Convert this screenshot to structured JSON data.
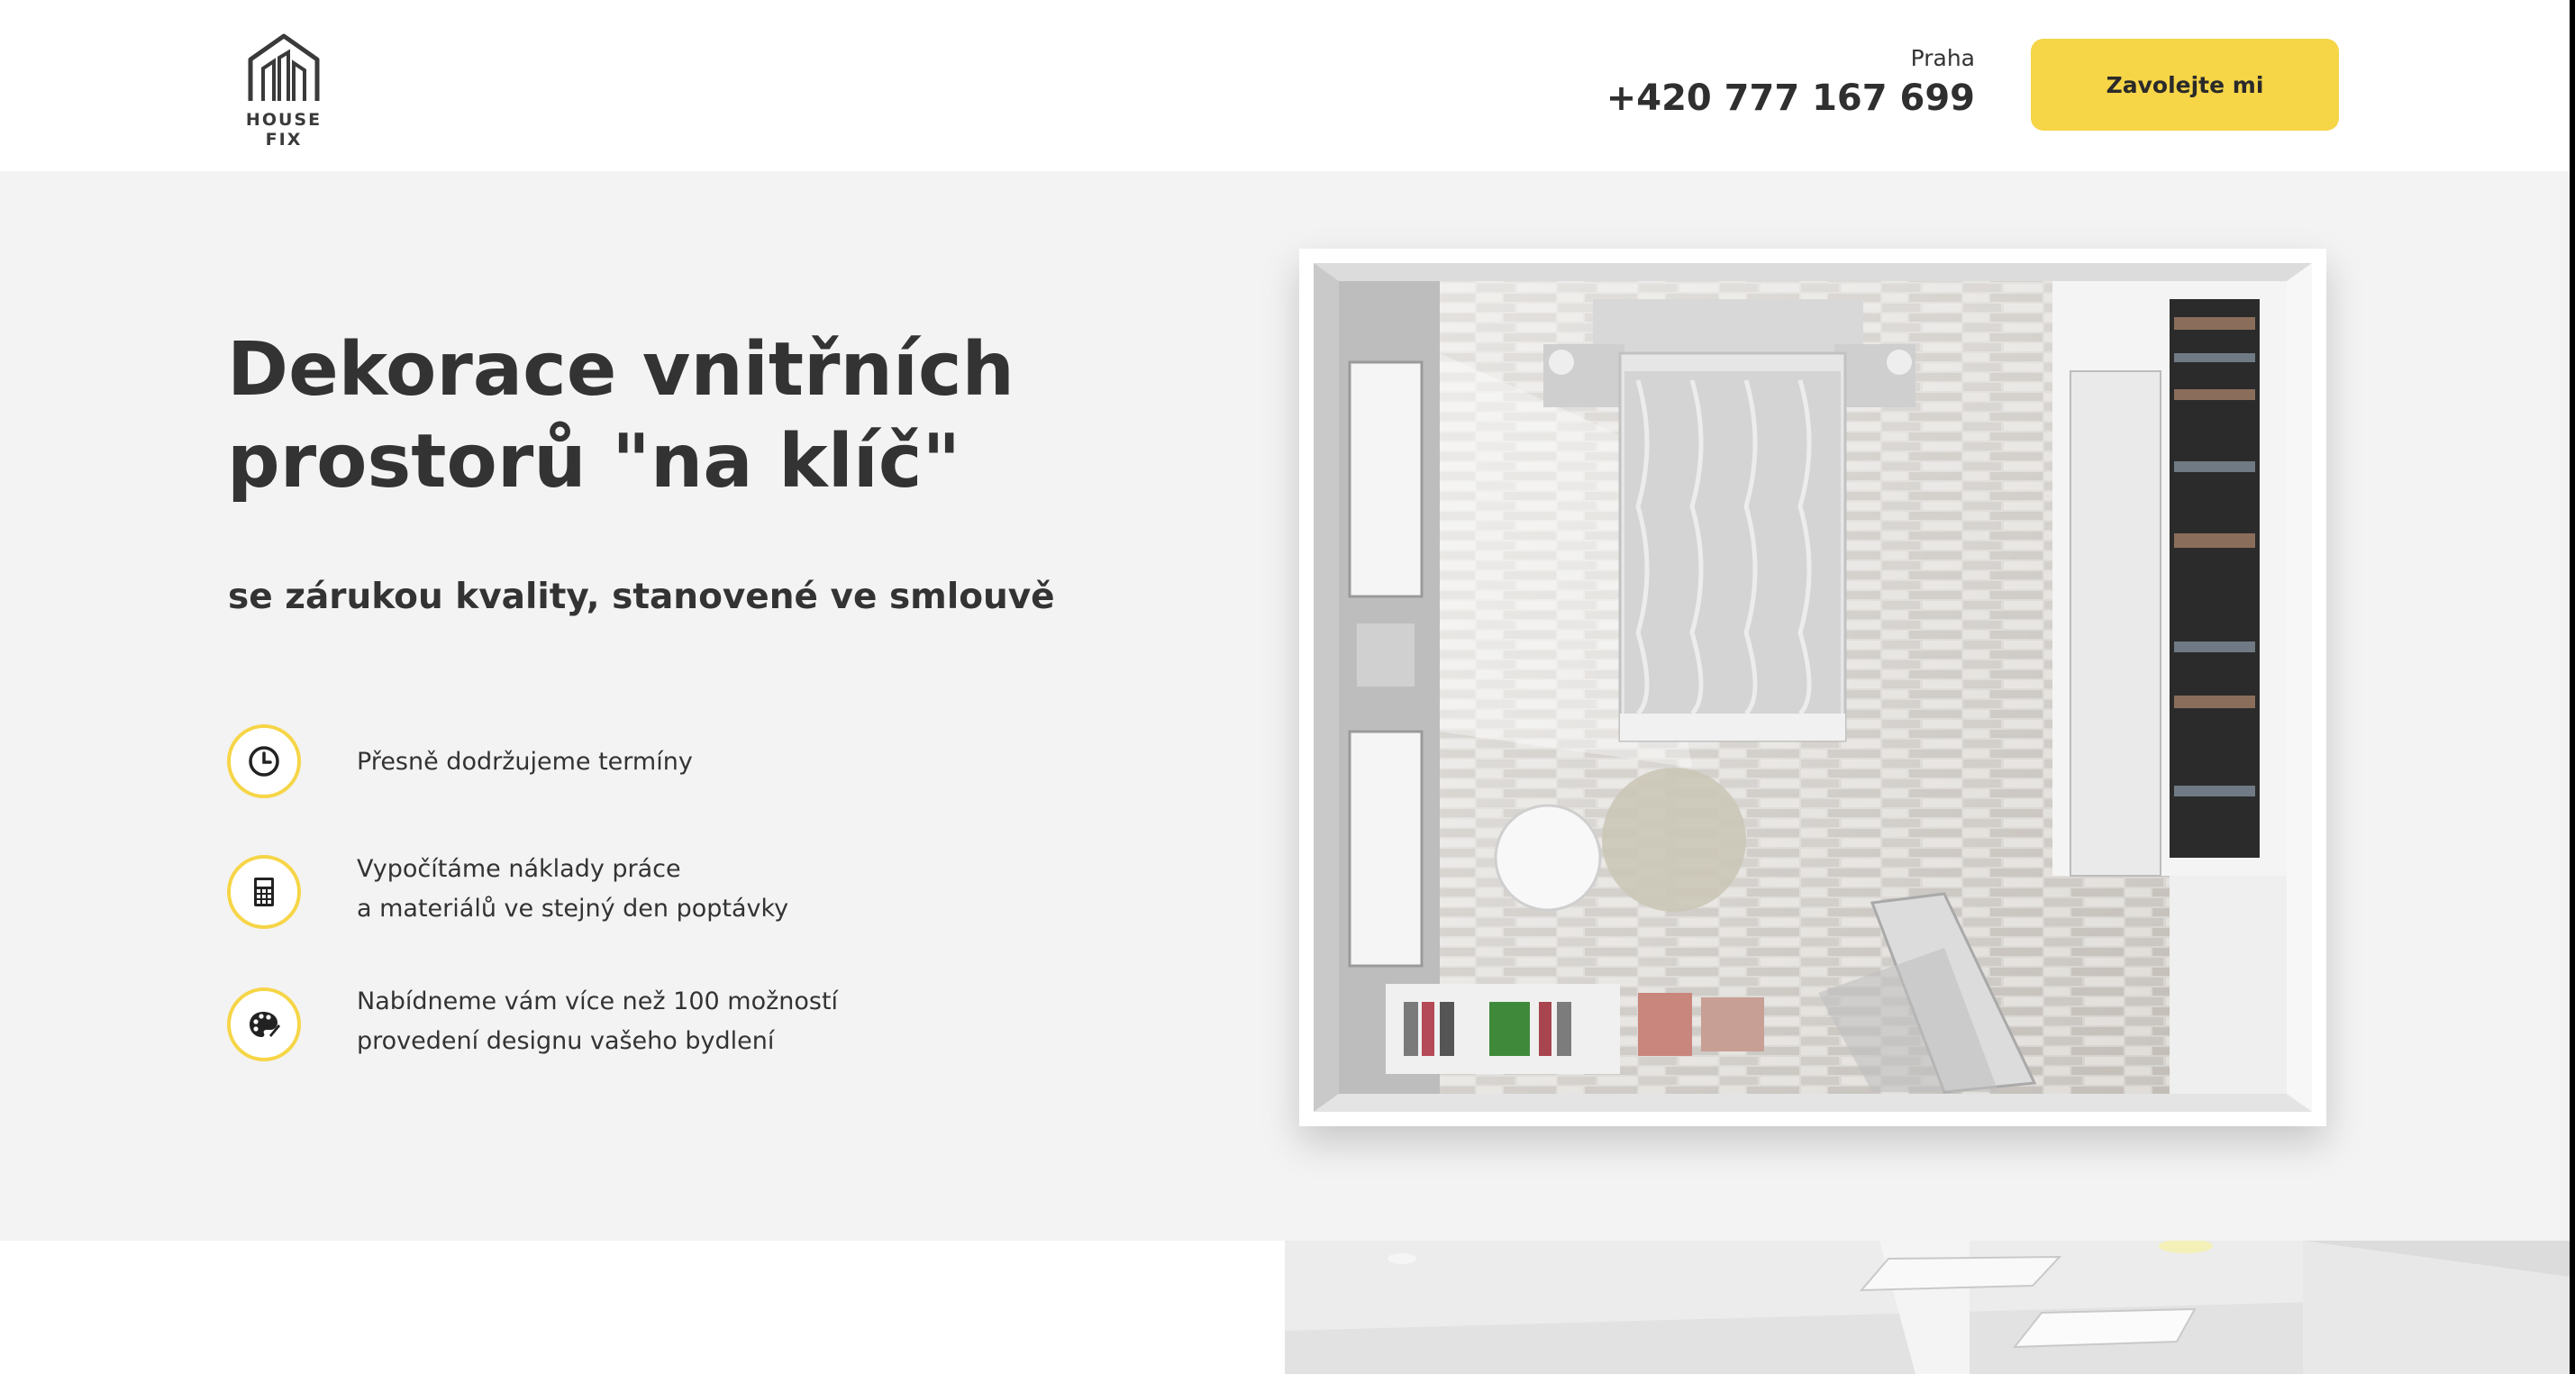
{
  "header": {
    "logo_text": "HOUSE FIX",
    "city": "Praha",
    "phone": "+420 777 167 699",
    "cta_label": "Zavolejte mi"
  },
  "hero": {
    "title": "Dekorace vnitřních prostorů \"na klíč\"",
    "subtitle": "se zárukou kvality, stanovené ve smlouvě",
    "features": [
      {
        "icon": "clock-icon",
        "line1": "Přesně dodržujeme termíny",
        "line2": ""
      },
      {
        "icon": "calculator-icon",
        "line1": "Vypočítáme náklady práce",
        "line2": "a materiálů ve stejný den poptávky"
      },
      {
        "icon": "palette-icon",
        "line1": "Nabídneme vám více než 100 možností",
        "line2": "provedení designu vašeho bydlení"
      }
    ]
  },
  "colors": {
    "accent": "#f6d547",
    "hero_bg": "#f3f3f3",
    "text": "#333333"
  }
}
